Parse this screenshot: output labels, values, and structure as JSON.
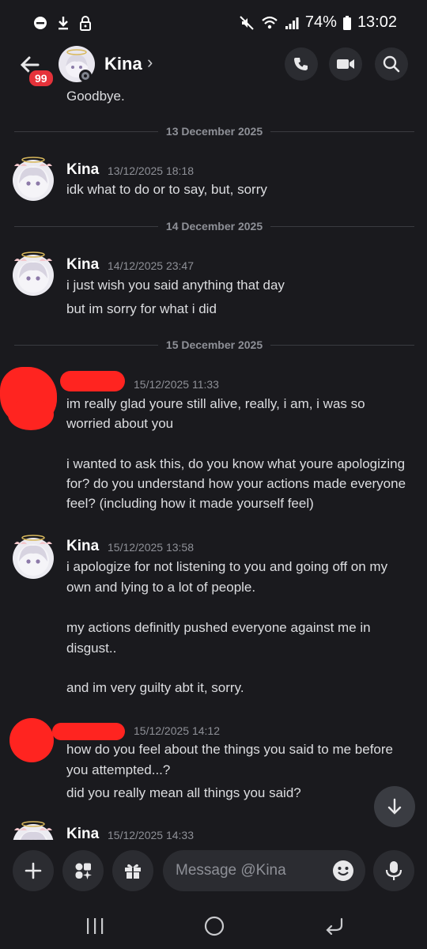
{
  "status_bar": {
    "battery": "74%",
    "time": "13:02"
  },
  "header": {
    "unread_badge": "99",
    "contact_name": "Kina",
    "chevron": "›"
  },
  "chat": {
    "partial_text": "Goodbye.",
    "dividers": [
      "13 December 2025",
      "14 December 2025",
      "15 December 2025"
    ],
    "messages": [
      {
        "author": "Kina",
        "timestamp": "13/12/2025 18:18",
        "lines": [
          "idk what to do or to say, but, sorry"
        ]
      },
      {
        "author": "Kina",
        "timestamp": "14/12/2025 23:47",
        "lines": [
          "i just wish you said anything that day",
          "but im sorry for what i did"
        ]
      },
      {
        "author": "",
        "timestamp": "15/12/2025 11:33",
        "lines": [
          "im really glad youre still alive, really, i am, i was so",
          "worried about you",
          "",
          "i wanted to ask this, do you know what youre apologizing",
          "for? do you understand how your actions made everyone",
          "feel? (including how it made yourself feel)"
        ]
      },
      {
        "author": "Kina",
        "timestamp": "15/12/2025 13:58",
        "lines": [
          "i apologize for not listening to you and going off on my",
          "own and lying to a lot of people.",
          "",
          "my actions definitly pushed everyone against me in",
          "disgust..",
          "",
          "and im very guilty abt it, sorry."
        ]
      },
      {
        "author": "",
        "timestamp": "15/12/2025 14:12",
        "lines": [
          "how do you feel about the things you said to me before",
          "you attempted...?",
          "did you really mean all things you said?"
        ]
      },
      {
        "author": "Kina",
        "timestamp": "15/12/2025 14:33",
        "lines": []
      }
    ]
  },
  "composer": {
    "placeholder": "Message @Kina"
  },
  "colors": {
    "background": "#1a1a1e",
    "badge": "#e5323a",
    "redaction": "#ff2420"
  }
}
